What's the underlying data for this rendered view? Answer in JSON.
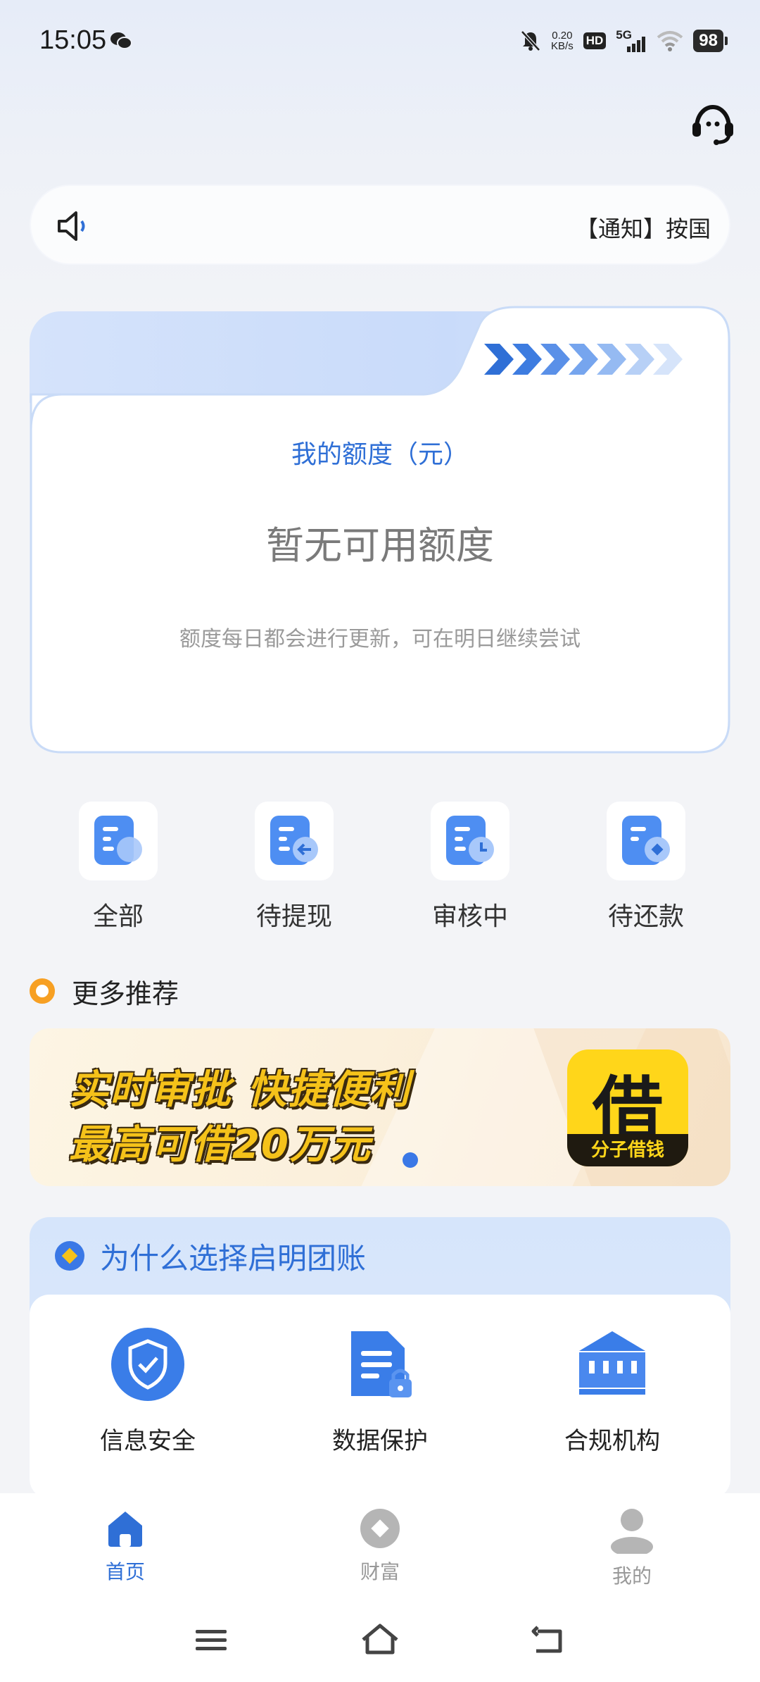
{
  "status_bar": {
    "time": "15:05",
    "net_speed_value": "0.20",
    "net_speed_unit": "KB/s",
    "hd": "HD",
    "network": "5G",
    "battery": "98"
  },
  "notice": {
    "text": "【通知】按国"
  },
  "quota": {
    "title": "我的额度（元）",
    "value": "暂无可用额度",
    "tip": "额度每日都会进行更新，可在明日继续尝试"
  },
  "quick_actions": [
    {
      "label": "全部"
    },
    {
      "label": "待提现"
    },
    {
      "label": "审核中"
    },
    {
      "label": "待还款"
    }
  ],
  "recommend": {
    "title": "更多推荐",
    "banner_line1": "实时审批 快捷便利",
    "banner_line2": "最高可借20万元",
    "logo_char": "借",
    "logo_sub": "分子借钱"
  },
  "why": {
    "title": "为什么选择启明团账",
    "items": [
      {
        "label": "信息安全"
      },
      {
        "label": "数据保护"
      },
      {
        "label": "合规机构"
      }
    ]
  },
  "bottom_nav": [
    {
      "label": "首页",
      "active": true
    },
    {
      "label": "财富",
      "active": false
    },
    {
      "label": "我的",
      "active": false
    }
  ],
  "colors": {
    "accent": "#2f6fd6",
    "section_dot": "#f7a023",
    "banner_text": "#f5c21a"
  }
}
